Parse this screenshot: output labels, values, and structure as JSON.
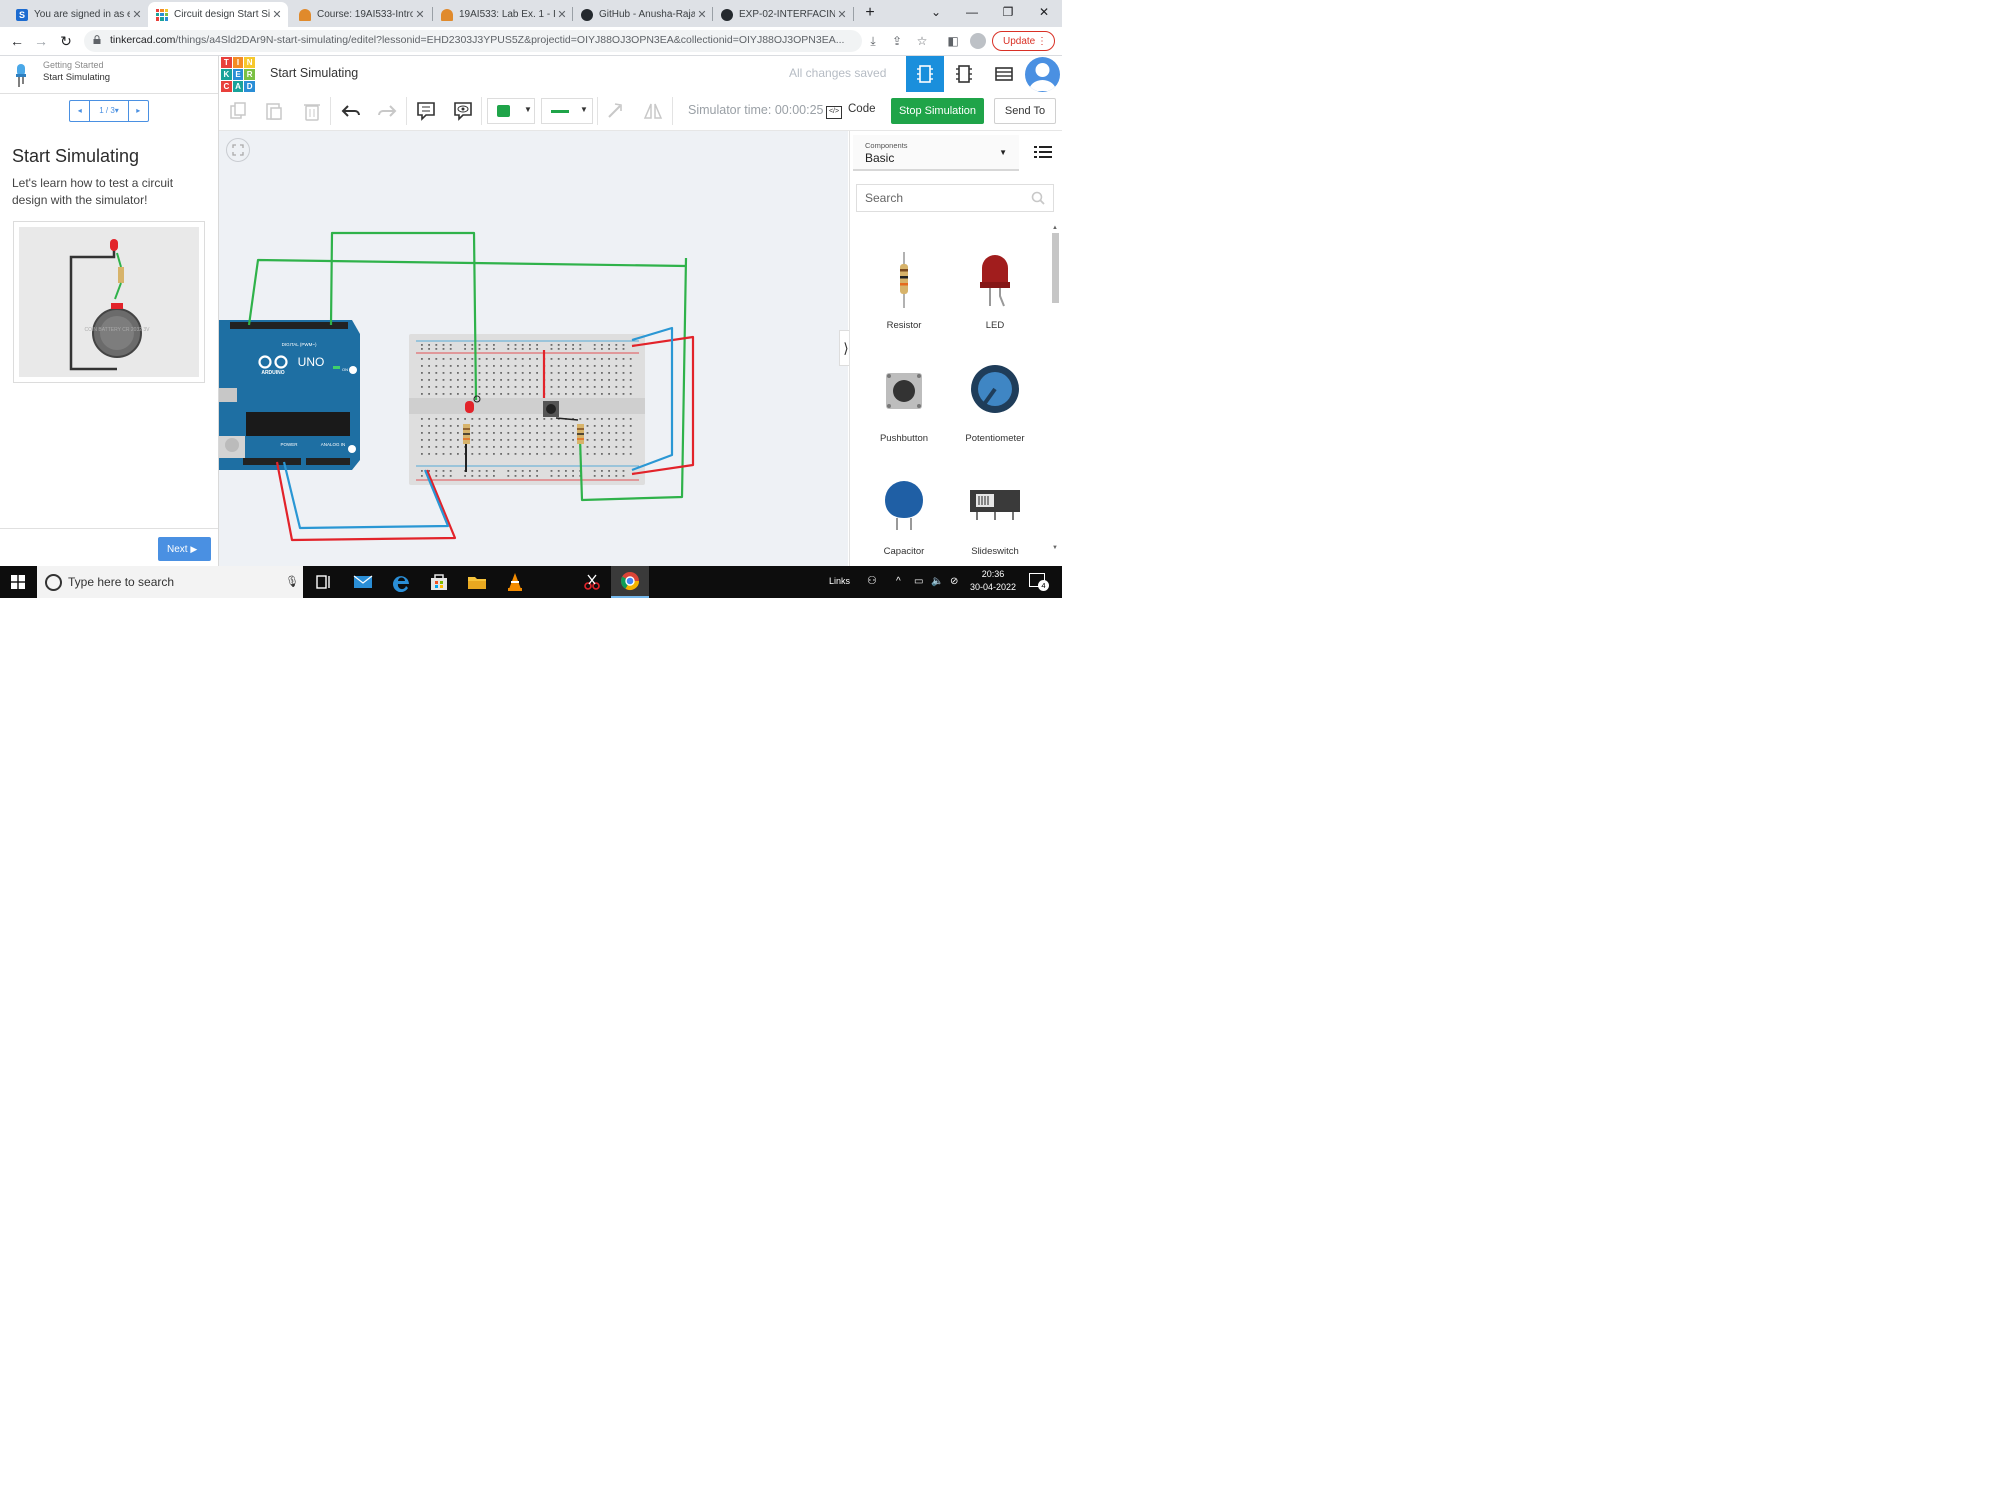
{
  "browser": {
    "tabs": [
      {
        "label": "You are signed in as e...",
        "favicon_color": "#1c6bd0"
      },
      {
        "label": "Circuit design Start Si...",
        "favicon_color": "#ff6a00"
      },
      {
        "label": "Course: 19AI533-Intro...",
        "favicon_color": "#e08a2c"
      },
      {
        "label": "19AI533: Lab Ex. 1 - In...",
        "favicon_color": "#e08a2c"
      },
      {
        "label": "GitHub - Anusha-Raja...",
        "favicon_color": "#24292e"
      },
      {
        "label": "EXP-02-INTERFACING...",
        "favicon_color": "#24292e"
      }
    ],
    "new_tab": "+",
    "url_host": "tinkercad.com",
    "url_path": "/things/a4Sld2DAr9N-start-simulating/editel?lessonid=EHD2303J3YPUS5Z&projectid=OIYJ88OJ3OPN3EA&collectionid=OIYJ88OJ3OPN3EA...",
    "update_label": "Update",
    "window_min": "—",
    "window_restore": "❐",
    "window_close": "✕",
    "tab_list": "⌄"
  },
  "lesson": {
    "subtitle": "Getting Started",
    "title": "Start Simulating",
    "page": "1 / 3",
    "heading": "Start Simulating",
    "description": "Let's learn how to test a circuit design with the simulator!",
    "battery_text": "COIN BATTERY CR 2032 3V",
    "next_label": "Next"
  },
  "editor": {
    "logo_letters": [
      "T",
      "I",
      "N",
      "K",
      "E",
      "R",
      "C",
      "A",
      "D"
    ],
    "logo_colors": [
      "#e8403b",
      "#f48b24",
      "#f6c82d",
      "#1aa29a",
      "#2a8ed6",
      "#7ac143",
      "#e8403b",
      "#1aa29a",
      "#2a8ed6"
    ],
    "title": "Start Simulating",
    "status": "All changes saved",
    "simulator_time": "Simulator time: 00:00:25",
    "code_label": "Code",
    "stop_label": "Stop Simulation",
    "send_label": "Send To",
    "fill_color": "#1fa449",
    "line_color": "#1fa449"
  },
  "board": {
    "brand": "ARDUINO",
    "model": "UNO",
    "digital": "DIGITAL (PWM~)",
    "power": "POWER",
    "analog": "ANALOG IN",
    "on": "ON"
  },
  "components": {
    "label": "Components",
    "value": "Basic",
    "search_placeholder": "Search",
    "items": [
      {
        "name": "Resistor"
      },
      {
        "name": "LED"
      },
      {
        "name": "Pushbutton"
      },
      {
        "name": "Potentiometer"
      },
      {
        "name": "Capacitor"
      },
      {
        "name": "Slideswitch"
      }
    ]
  },
  "taskbar": {
    "search_placeholder": "Type here to search",
    "links_label": "Links",
    "time": "20:36",
    "date": "30-04-2022",
    "notifications": "4"
  },
  "colors": {
    "accent": "#4a90e2",
    "stop_green": "#1fa449",
    "wire_green": "#2fb24a",
    "wire_red": "#e2232a",
    "wire_blue": "#2a97d4",
    "arduino_blue": "#1e6fa3"
  }
}
